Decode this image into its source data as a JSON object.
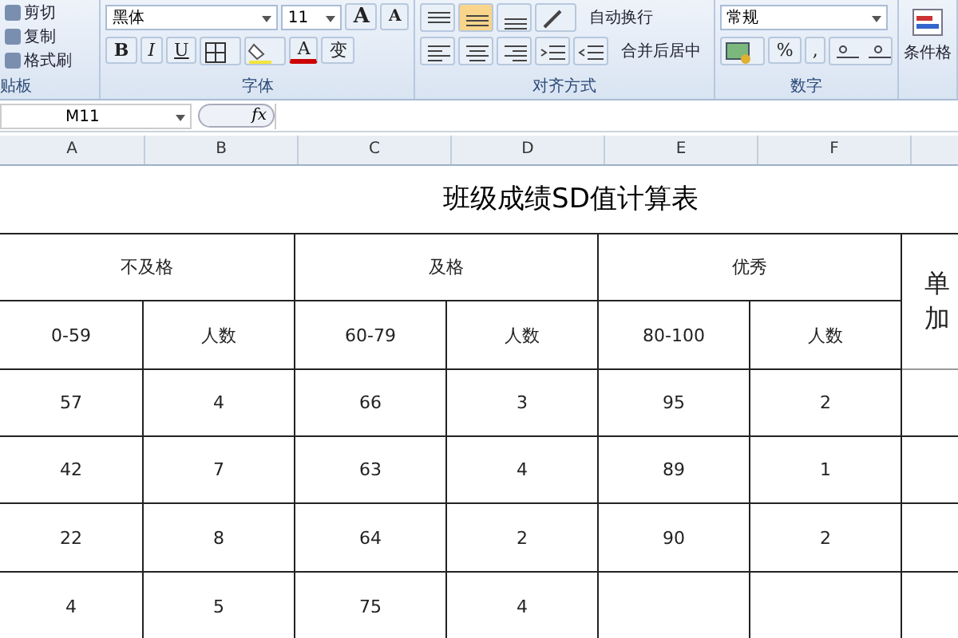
{
  "ribbon": {
    "clipboard": {
      "items": [
        "剪切",
        "复制",
        "格式刷"
      ],
      "label": "贴板"
    },
    "font": {
      "name": "黑体",
      "size": "11",
      "grow": "A",
      "shrink": "A",
      "bold": "B",
      "italic": "I",
      "underline": "U",
      "color_letter": "A",
      "phonetic": "变",
      "label": "字体"
    },
    "alignment": {
      "wrap": "自动换行",
      "merge": "合并后居中",
      "label": "对齐方式"
    },
    "number": {
      "format": "常规",
      "percent": "%",
      "comma": ",",
      "label": "数字"
    },
    "styles": {
      "conditional": "条件格"
    }
  },
  "formula_bar": {
    "name_box": "M11",
    "fx": "fx"
  },
  "columns": [
    "A",
    "B",
    "C",
    "D",
    "E",
    "F"
  ],
  "sheet": {
    "title": "班级成绩SD值计算表",
    "groups": [
      "不及格",
      "及格",
      "优秀"
    ],
    "side_header": [
      "单",
      "加"
    ],
    "subheaders": [
      "0-59",
      "人数",
      "60-79",
      "人数",
      "80-100",
      "人数"
    ],
    "rows": [
      [
        "57",
        "4",
        "66",
        "3",
        "95",
        "2"
      ],
      [
        "42",
        "7",
        "63",
        "4",
        "89",
        "1"
      ],
      [
        "22",
        "8",
        "64",
        "2",
        "90",
        "2"
      ],
      [
        "4",
        "5",
        "75",
        "4"
      ]
    ]
  }
}
